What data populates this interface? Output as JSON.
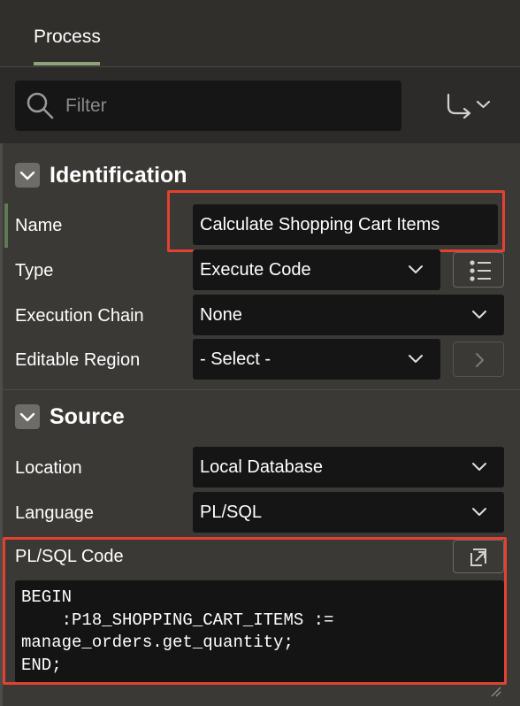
{
  "tabs": {
    "process_label": "Process"
  },
  "filter": {
    "placeholder": "Filter"
  },
  "identification": {
    "title": "Identification",
    "name_label": "Name",
    "name_value": "Calculate Shopping Cart Items",
    "type_label": "Type",
    "type_value": "Execute Code",
    "chain_label": "Execution Chain",
    "chain_value": "None",
    "region_label": "Editable Region",
    "region_value": "- Select -"
  },
  "source": {
    "title": "Source",
    "location_label": "Location",
    "location_value": "Local Database",
    "language_label": "Language",
    "language_value": "PL/SQL",
    "code_label": "PL/SQL Code",
    "code": "BEGIN\n    :P18_SHOPPING_CART_ITEMS :=\nmanage_orders.get_quantity;\nEND;"
  },
  "colors": {
    "highlight": "#e2422f",
    "tab_underline": "#8fa37a",
    "background": "#3a3936"
  }
}
